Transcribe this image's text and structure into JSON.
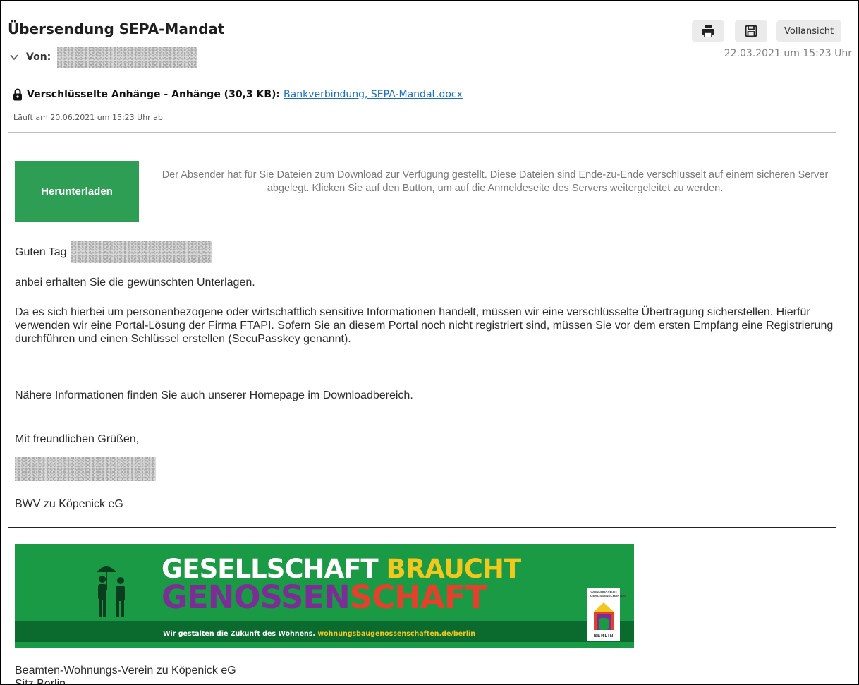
{
  "email": {
    "subject": "Übersendung SEPA-Mandat",
    "from_label": "Von:",
    "date": "22.03.2021 um 15:23 Uhr"
  },
  "toolbar": {
    "print_icon": "printer-icon",
    "save_icon": "save-icon",
    "full_view_label": "Vollansicht"
  },
  "attachment": {
    "lock_icon": "lock-icon",
    "title": "Verschlüsselte Anhänge - Anhänge (30,3 KB):",
    "files_link": "Bankverbindung, SEPA-Mandat.docx",
    "expiry": "Läuft am 20.06.2021 um 15:23 Uhr ab"
  },
  "download": {
    "button_label": "Herunterladen",
    "info_text": "Der Absender hat für Sie Dateien zum Download zur Verfügung gestellt. Diese Dateien sind Ende-zu-Ende verschlüsselt auf einem sicheren Server abgelegt. Klicken Sie auf den Button, um auf die Anmeldeseite des Servers weitergeleitet zu werden."
  },
  "body": {
    "greeting": "Guten Tag",
    "p1": "anbei erhalten Sie die gewünschten Unterlagen.",
    "p2": "Da es sich hierbei um personenbezogene oder wirtschaftlich sensitive Informationen handelt, müssen wir eine verschlüsselte Übertragung sicherstellen. Hierfür verwenden wir eine Portal-Lösung der Firma FTAPI. Sofern Sie an diesem Portal noch nicht registriert sind, müssen Sie vor dem ersten Empfang eine Registrierung durchführen und einen Schlüssel erstellen (SecuPasskey genannt).",
    "p3": "Nähere Informationen finden Sie auch unserer Homepage im Downloadbereich.",
    "closing": "Mit freundlichen Grüßen,",
    "company": "BWV zu Köpenick eG"
  },
  "banner": {
    "line1_a": "GESELLSCHAFT",
    "line1_b": "BRAUCHT",
    "line2_a": "GENOSSEN",
    "line2_b": "SCHAFT",
    "tagline": "Wir gestalten die Zukunft des Wohnens.",
    "tagline_url": "wohnungsbaugenossenschaften.de/berlin",
    "logo_top": "WOHNUNGSBAU\nGENOSSENSCHAFTEN",
    "logo_bottom": "BERLIN",
    "colors": {
      "green": "#1b9a45",
      "yellow": "#f2c81c",
      "purple": "#7b2f96",
      "red": "#e5402c"
    }
  },
  "footer": {
    "line1": "Beamten-Wohnungs-Verein zu Köpenick eG",
    "line2": "Sitz Berlin"
  }
}
